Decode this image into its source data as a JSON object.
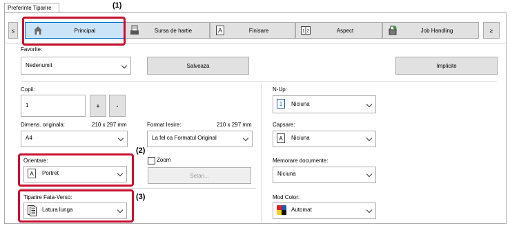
{
  "window": {
    "tab_title": "Preferinte Tiparire"
  },
  "toolbar": {
    "scroll_left": "≤",
    "tabs": [
      {
        "label": "Principal",
        "icon": "house-icon"
      },
      {
        "label": "Sursa de hartie",
        "icon": "paper-tray-icon"
      },
      {
        "label": "Finisare",
        "icon": "finishing-icon"
      },
      {
        "label": "Aspect",
        "icon": "layout-icon"
      },
      {
        "label": "Job Handling",
        "icon": "job-handling-icon"
      }
    ],
    "scroll_right": "≥"
  },
  "favorites": {
    "label": "Favorite:",
    "value": "Nedenumit",
    "save_label": "Salveaza",
    "default_label": "Implicite"
  },
  "copies": {
    "label": "Copii:",
    "value": "1",
    "plus": "+",
    "minus": "-"
  },
  "original_size": {
    "label": "Dimens. originala:",
    "dims": "210 x 297 mm",
    "value": "A4"
  },
  "output_size": {
    "label": "Format Iesire:",
    "dims": "210 x 297 mm",
    "value": "La fel ca Formatul Original"
  },
  "orientation": {
    "label": "Orientare:",
    "value": "Portret",
    "icon_glyph": "A"
  },
  "zoom": {
    "label": "Zoom",
    "settings_label": "Setari..."
  },
  "duplex": {
    "label": "Tiparire Fata-Verso:",
    "value": "Latura lunga"
  },
  "nup": {
    "label": "N-Up:",
    "value": "Niciuna",
    "icon_glyph": "1"
  },
  "cover": {
    "label": "Capsare:",
    "value": "Niciuna",
    "icon_glyph": "A"
  },
  "doc_storage": {
    "label": "Memorare documente:",
    "value": "Niciuna"
  },
  "color_mode": {
    "label": "Mod Color:",
    "value": "Automat"
  },
  "callouts": {
    "c1": "(1)",
    "c2": "(2)",
    "c3": "(3)"
  },
  "colors": {
    "highlight": "#c8102e",
    "button_face": "#e1e1e1",
    "border": "#adadad"
  }
}
